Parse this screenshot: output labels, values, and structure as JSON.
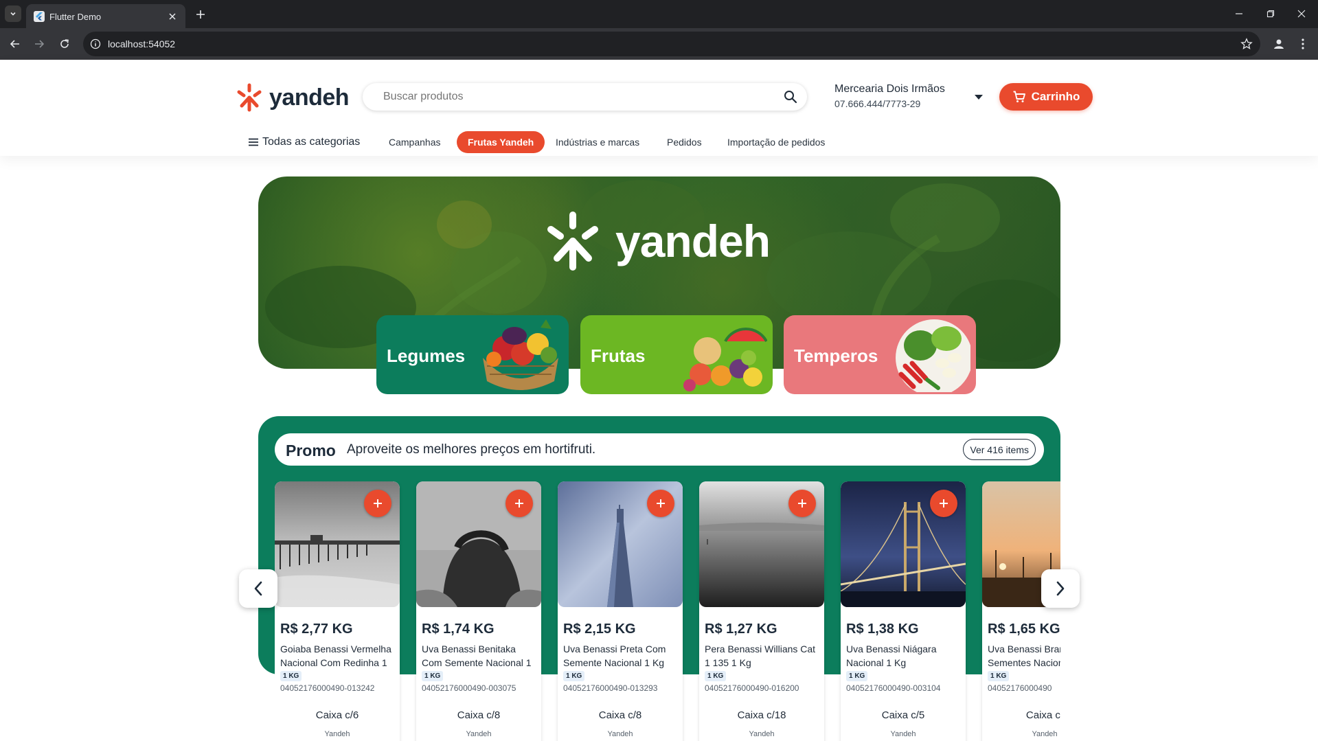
{
  "browser": {
    "tab_title": "Flutter Demo",
    "url": "localhost:54052"
  },
  "header": {
    "brand": "yandeh",
    "search_placeholder": "Buscar produtos",
    "store_name": "Mercearia Dois Irmãos",
    "store_document": "07.666.444/7773-29",
    "cart_label": "Carrinho"
  },
  "nav": {
    "all_categories": "Todas as categorias",
    "items": [
      "Campanhas",
      "Frutas Yandeh",
      "Indústrias e marcas",
      "Pedidos",
      "Importação de pedidos"
    ],
    "active": "Frutas Yandeh"
  },
  "hero": {
    "brand": "yandeh",
    "categories": [
      {
        "label": "Legumes",
        "color": "#0c7d5c"
      },
      {
        "label": "Frutas",
        "color": "#6cb723"
      },
      {
        "label": "Temperos",
        "color": "#e9787c"
      }
    ]
  },
  "promo": {
    "title": "Promo",
    "subtitle": "Aproveite os melhores preços em hortifruti.",
    "see_all": "Ver 416 items",
    "products": [
      {
        "price": "R$ 2,77 KG",
        "name": "Goiaba Benassi Vermelha Nacional Com Redinha 1",
        "unit": "1 KG",
        "code": "04052176000490-013242",
        "box": "Caixa c/6",
        "brand": "Yandeh",
        "image": "pier"
      },
      {
        "price": "R$ 1,74 KG",
        "name": "Uva Benassi Benitaka Com Semente Nacional 1",
        "unit": "1 KG",
        "code": "04052176000490-003075",
        "box": "Caixa c/8",
        "brand": "Yandeh",
        "image": "person"
      },
      {
        "price": "R$ 2,15 KG",
        "name": "Uva Benassi Preta Com Semente Nacional 1 Kg",
        "unit": "1 KG",
        "code": "04052176000490-013293",
        "box": "Caixa c/8",
        "brand": "Yandeh",
        "image": "tower"
      },
      {
        "price": "R$ 1,27 KG",
        "name": "Pera Benassi Willians Cat 1 135 1 Kg",
        "unit": "1 KG",
        "code": "04052176000490-016200",
        "box": "Caixa c/18",
        "brand": "Yandeh",
        "image": "sea"
      },
      {
        "price": "R$ 1,38 KG",
        "name": "Uva Benassi Niágara Nacional 1 Kg",
        "unit": "1 KG",
        "code": "04052176000490-003104",
        "box": "Caixa c/5",
        "brand": "Yandeh",
        "image": "bridge"
      },
      {
        "price": "R$ 1,65 KG",
        "name": "Uva Benassi Branca Sementes Nacional",
        "unit": "1 KG",
        "code": "04052176000490",
        "box": "Caixa c/",
        "brand": "Yandeh",
        "image": "sunset"
      }
    ]
  },
  "colors": {
    "accent": "#e94a2d",
    "promo_bg": "#0c7d5c",
    "hero_bg": "#2f6428"
  }
}
